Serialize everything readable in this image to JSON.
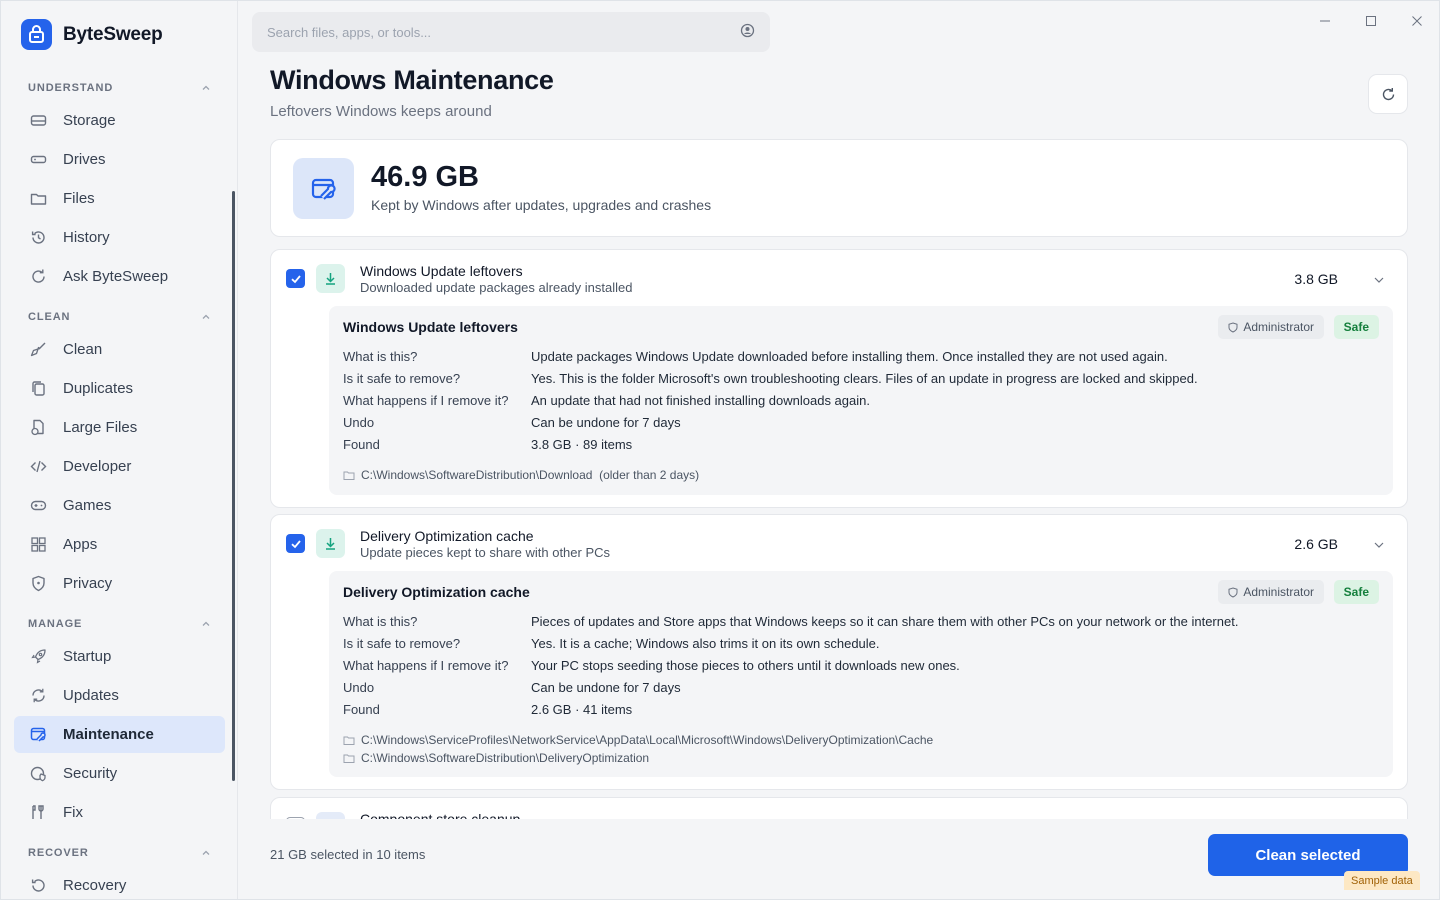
{
  "app": {
    "name": "ByteSweep"
  },
  "search": {
    "placeholder": "Search files, apps, or tools..."
  },
  "sidebar": {
    "sections": [
      {
        "label": "UNDERSTAND",
        "items": [
          "Storage",
          "Drives",
          "Files",
          "History",
          "Ask ByteSweep"
        ]
      },
      {
        "label": "CLEAN",
        "items": [
          "Clean",
          "Duplicates",
          "Large Files",
          "Developer",
          "Games",
          "Apps",
          "Privacy"
        ]
      },
      {
        "label": "MANAGE",
        "items": [
          "Startup",
          "Updates",
          "Maintenance",
          "Security",
          "Fix"
        ]
      },
      {
        "label": "RECOVER",
        "items": [
          "Recovery"
        ]
      }
    ],
    "active_item": "Maintenance"
  },
  "page": {
    "title": "Windows Maintenance",
    "subtitle": "Leftovers Windows keeps around"
  },
  "summary": {
    "size": "46.9 GB",
    "description": "Kept by Windows after updates, upgrades and crashes"
  },
  "labels": {
    "what": "What is this?",
    "safe": "Is it safe to remove?",
    "happens": "What happens if I remove it?",
    "undo": "Undo",
    "found": "Found",
    "admin": "Administrator",
    "safe_badge": "Safe"
  },
  "items": [
    {
      "checked": true,
      "title": "Windows Update leftovers",
      "subtitle": "Downloaded update packages already installed",
      "size": "3.8 GB",
      "what": "Update packages Windows Update downloaded before installing them. Once installed they are not used again.",
      "safe": "Yes. This is the folder Microsoft's own troubleshooting clears. Files of an update in progress are locked and skipped.",
      "happens": "An update that had not finished installing downloads again.",
      "undo": "Can be undone for 7 days",
      "found": "3.8 GB · 89 items",
      "paths": [
        "C:\\Windows\\SoftwareDistribution\\Download  (older than 2 days)"
      ]
    },
    {
      "checked": true,
      "title": "Delivery Optimization cache",
      "subtitle": "Update pieces kept to share with other PCs",
      "size": "2.6 GB",
      "what": "Pieces of updates and Store apps that Windows keeps so it can share them with other PCs on your network or the internet.",
      "safe": "Yes. It is a cache; Windows also trims it on its own schedule.",
      "happens": "Your PC stops seeding those pieces to others until it downloads new ones.",
      "undo": "Can be undone for 7 days",
      "found": "2.6 GB · 41 items",
      "paths": [
        "C:\\Windows\\ServiceProfiles\\NetworkService\\AppData\\Local\\Microsoft\\Windows\\DeliveryOptimization\\Cache",
        "C:\\Windows\\SoftwareDistribution\\DeliveryOptimization"
      ]
    },
    {
      "checked": false,
      "title": "Component store cleanup"
    }
  ],
  "footer": {
    "selection": "21 GB selected in 10 items",
    "clean_button": "Clean selected",
    "sample_tag": "Sample data"
  },
  "colors": {
    "accent": "#2563eb",
    "active_nav_bg": "#dde7fb",
    "safe_green": "#15803d",
    "item_icon_bg": "#dcf3ec"
  }
}
